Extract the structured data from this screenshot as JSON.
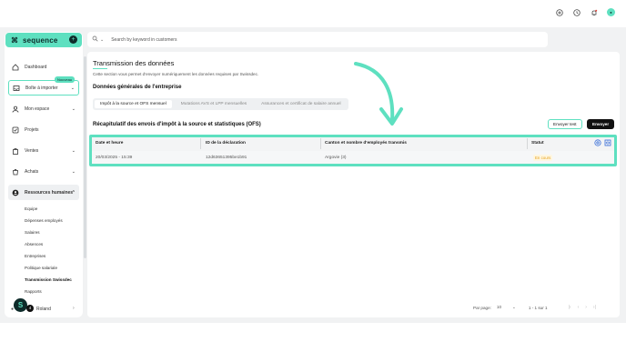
{
  "app": {
    "logo_text": "sequence",
    "logo_mark": "⌘",
    "logo_add_icon": "plus-circle-icon"
  },
  "sidebar": {
    "items": [
      {
        "label": "Dashboard",
        "icon": "home-icon"
      },
      {
        "label": "Boîte à importer",
        "icon": "inbox-icon",
        "badge": "Nouveau"
      },
      {
        "label": "Mon espace",
        "icon": "user-icon"
      },
      {
        "label": "Projets",
        "icon": "checkbox-icon"
      },
      {
        "label": "Ventes",
        "icon": "bag-icon"
      },
      {
        "label": "Achats",
        "icon": "cart-icon"
      },
      {
        "label": "Ressources humaines",
        "icon": "people-icon"
      }
    ],
    "sub_items": [
      "Equipe",
      "Dépenses employés",
      "Salaires",
      "Absences",
      "Entreprises",
      "Politique salariale",
      "Transmission Swissdec",
      "Rapports"
    ],
    "user": {
      "name": "Roland",
      "avatar_letter": "S",
      "count": "4"
    }
  },
  "topbar": {
    "search_placeholder": "Search by keyword in customers"
  },
  "page": {
    "title": "Transmission des données",
    "description": "Cette section vous permet d'envoyer numériquement les données requises par Swissdec.",
    "section_title": "Données générales de l'entreprise",
    "tabs": [
      "Impôt à la source et OFS mensuel",
      "Mutations AVS et LPP mensuelles",
      "Assurances et certificat de salaire annuel"
    ],
    "recap_title": "Récapitulatif des envois d'impôt à la source et statistiques (OFS)",
    "buttons": {
      "test": "Envoyer test",
      "send": "Envoyer"
    }
  },
  "table": {
    "headers": [
      "Date et heure",
      "ID de la déclaration",
      "Canton et nombre d'employés transmis",
      "Statut"
    ],
    "rows": [
      {
        "date": "20/03/2025 - 15:39",
        "id": "12d63651395be1b91",
        "canton": "Argovie (3)",
        "status": "En cours"
      }
    ]
  },
  "pagination": {
    "per_page_label": "Par page:",
    "per_page_value": "10",
    "range": "1 - 1 sur 1"
  },
  "colors": {
    "accent": "#5ee0c0",
    "status_pending": "#e6a21a"
  }
}
